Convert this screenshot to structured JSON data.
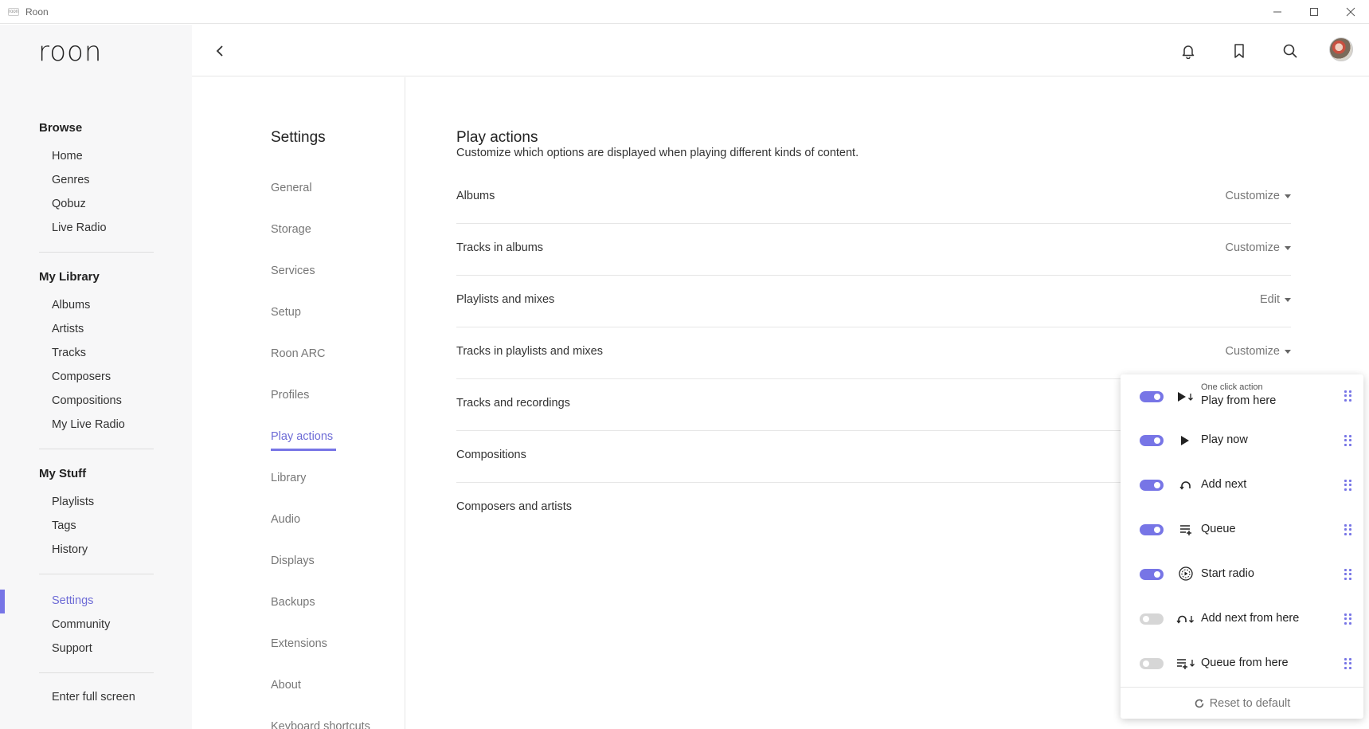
{
  "window": {
    "title": "Roon",
    "app_icon_text": "roon"
  },
  "sidebar": {
    "logo": "roon",
    "browse": {
      "heading": "Browse",
      "items": [
        "Home",
        "Genres",
        "Qobuz",
        "Live Radio"
      ]
    },
    "library": {
      "heading": "My Library",
      "items": [
        "Albums",
        "Artists",
        "Tracks",
        "Composers",
        "Compositions",
        "My Live Radio"
      ]
    },
    "stuff": {
      "heading": "My Stuff",
      "items": [
        "Playlists",
        "Tags",
        "History"
      ]
    },
    "misc": {
      "items": [
        "Settings",
        "Community",
        "Support"
      ]
    },
    "fullscreen": "Enter full screen"
  },
  "settings_nav": {
    "title": "Settings",
    "items": [
      "General",
      "Storage",
      "Services",
      "Setup",
      "Roon ARC",
      "Profiles",
      "Play actions",
      "Library",
      "Audio",
      "Displays",
      "Backups",
      "Extensions",
      "About",
      "Keyboard shortcuts"
    ],
    "active": "Play actions"
  },
  "main": {
    "title": "Play actions",
    "subtitle": "Customize which options are displayed when playing different kinds of content.",
    "rows": [
      {
        "label": "Albums",
        "action": "Customize"
      },
      {
        "label": "Tracks in albums",
        "action": "Customize"
      },
      {
        "label": "Playlists and mixes",
        "action": "Edit"
      },
      {
        "label": "Tracks in playlists and mixes",
        "action": "Customize"
      },
      {
        "label": "Tracks and recordings",
        "action": ""
      },
      {
        "label": "Compositions",
        "action": ""
      },
      {
        "label": "Composers and artists",
        "action": ""
      }
    ]
  },
  "popup": {
    "one_click_label": "One click action",
    "items": [
      {
        "label": "Play from here",
        "enabled": true,
        "icon": "play-from-here-icon"
      },
      {
        "label": "Play now",
        "enabled": true,
        "icon": "play-icon"
      },
      {
        "label": "Add next",
        "enabled": true,
        "icon": "add-next-icon"
      },
      {
        "label": "Queue",
        "enabled": true,
        "icon": "queue-icon"
      },
      {
        "label": "Start radio",
        "enabled": true,
        "icon": "radio-icon"
      },
      {
        "label": "Add next from here",
        "enabled": false,
        "icon": "add-next-from-here-icon"
      },
      {
        "label": "Queue from here",
        "enabled": false,
        "icon": "queue-from-here-icon"
      }
    ],
    "reset_label": "Reset to default"
  },
  "colors": {
    "accent": "#7775e6",
    "text": "#222222",
    "muted": "#777777",
    "sidebar_bg": "#f7f7f8"
  }
}
